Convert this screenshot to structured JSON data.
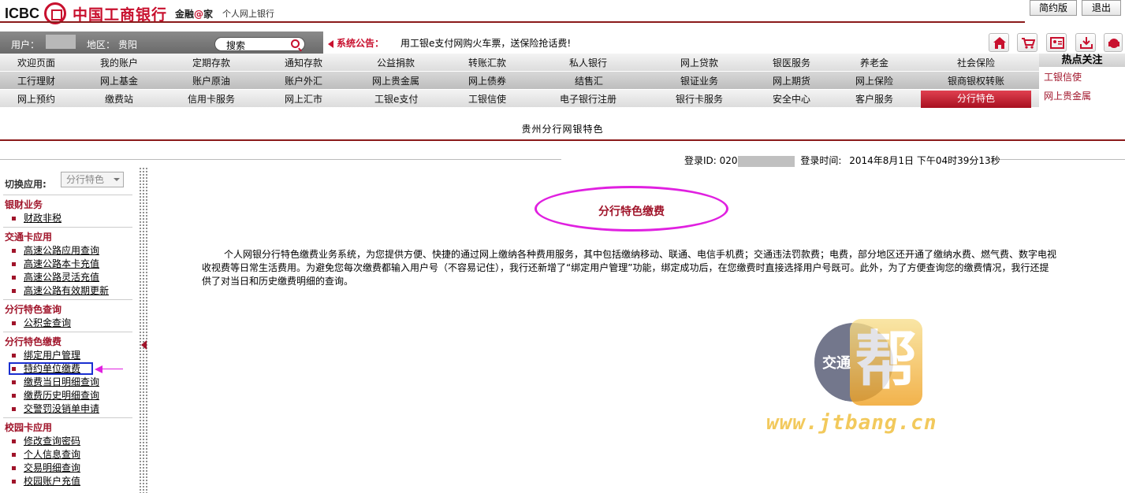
{
  "header": {
    "logo_text": "ICBC",
    "bank_name": "中国工商银行",
    "slogan_pre": "金融",
    "slogan_at": "@",
    "slogan_post": "家",
    "subtitle": "个人网上银行",
    "simple_btn": "简约版",
    "logout_btn": "退出"
  },
  "userbar": {
    "user_label": "用户：",
    "area_label": "地区：",
    "area_value": "贵阳",
    "search_label": "搜索"
  },
  "notice": {
    "label": "系统公告：",
    "text": "用工银e支付网购火车票，送保险抢话费!"
  },
  "quick_icons": [
    "home-icon",
    "cart-icon",
    "contacts-icon",
    "download-icon",
    "service-icon"
  ],
  "nav": {
    "row1": [
      "欢迎页面",
      "我的账户",
      "定期存款",
      "通知存款",
      "公益捐款",
      "转账汇款",
      "私人银行",
      "网上贷款",
      "银医服务",
      "养老金",
      "社会保险"
    ],
    "row2": [
      "工行理财",
      "网上基金",
      "账户原油",
      "账户外汇",
      "网上贵金属",
      "网上债券",
      "结售汇",
      "银证业务",
      "网上期货",
      "网上保险",
      "银商银权转账"
    ],
    "row3": [
      "网上预约",
      "缴费站",
      "信用卡服务",
      "网上汇市",
      "工银e支付",
      "工银信使",
      "电子银行注册",
      "银行卡服务",
      "安全中心",
      "客户服务"
    ],
    "active": "分行特色"
  },
  "hot": {
    "title": "热点关注",
    "items": [
      "工银信使",
      "网上贵金属"
    ]
  },
  "page_title": "贵州分行网银特色",
  "login": {
    "id_label": "登录ID: 020",
    "time_label": "登录时间:",
    "time_value": "2014年8月1日 下午04时39分13秒"
  },
  "sidebar": {
    "switch_label": "切换应用:",
    "switch_value": "分行特色",
    "groups": [
      {
        "title": "银财业务",
        "items": [
          "财政非税"
        ]
      },
      {
        "title": "交通卡应用",
        "items": [
          "高速公路应用查询",
          "高速公路本卡充值",
          "高速公路灵活充值",
          "高速公路有效期更新"
        ]
      },
      {
        "title": "分行特色查询",
        "items": [
          "公积金查询"
        ]
      },
      {
        "title": "分行特色缴费",
        "items": [
          "绑定用户管理",
          "特约单位缴费",
          "缴费当日明细查询",
          "缴费历史明细查询",
          "交警罚没销单申请"
        ]
      },
      {
        "title": "校园卡应用",
        "items": [
          "修改查询密码",
          "个人信息查询",
          "交易明细查询",
          "校园账户充值"
        ]
      }
    ]
  },
  "main": {
    "heading": "分行特色缴费",
    "description": "个人网银分行特色缴费业务系统，为您提供方便、快捷的通过网上缴纳各种费用服务，其中包括缴纳移动、联通、电信手机费；交通违法罚款费；电费，部分地区还开通了缴纳水费、燃气费、数字电视收视费等日常生活费用。为避免您每次缴费都输入用户号（不容易记住），我行还新增了“绑定用户管理”功能，绑定成功后，在您缴费时直接选择用户号既可。此外，为了方便查询您的缴费情况，我行还提供了对当日和历史缴费明细的查询。"
  },
  "watermark": {
    "circle_text": "交通",
    "big_char": "帮",
    "url": "www.jtbang.cn"
  },
  "colors": {
    "brand_red": "#c8102e",
    "menu_red": "#a0142a",
    "highlight_magenta": "#e020e0",
    "highlight_blue": "#1a2fd0"
  }
}
